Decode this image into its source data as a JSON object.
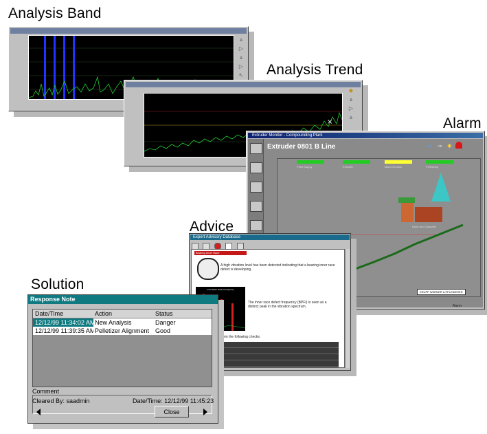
{
  "labels": {
    "analysis_band": "Analysis Band",
    "analysis_trend": "Analysis Trend",
    "alarm": "Alarm",
    "advice": "Advice",
    "solution": "Solution"
  },
  "alarm_window": {
    "title": "Extruder Monitor - Compounding Plant",
    "heading": "Extruder 0801 B Line",
    "indicators": [
      {
        "label": "Feed Supply",
        "color": "#22cc22"
      },
      {
        "label": "Extruder",
        "color": "#22cc22"
      },
      {
        "label": "Main Electrics",
        "color": "#ffff33"
      },
      {
        "label": "Pelletizing",
        "color": "#22cc22"
      }
    ],
    "equipment_label": "Dryer and Classifier",
    "vendor": "KRUPP WERNER & PFLEIDERER",
    "status_left": "Alarm"
  },
  "advice_window": {
    "title": "Expert Advisory Database",
    "header": "Bearing Inner Race",
    "text_1": "A high vibration level has been detected indicating that a bearing inner race defect is developing.",
    "spectrum_title": "Inner Race Defect Frequency",
    "text_2": "The inner race defect frequency (BPFI) is seen as a distinct peak in the vibration spectrum.",
    "text_3": "You must first perform the following checks:"
  },
  "response_note": {
    "title": "Response Note",
    "columns": [
      "Date/Time",
      "Action",
      "Status"
    ],
    "rows": [
      {
        "datetime": "12/12/99 11:34:02 AM",
        "action": "New Analysis",
        "status": "Danger"
      },
      {
        "datetime": "12/12/99 11:39:35 AM",
        "action": "Pelletizer Alignment",
        "status": "Good"
      }
    ],
    "comment_label": "Comment",
    "cleared_by": "Cleared By: saadmin",
    "date_time": "Date/Time:  12/12/99 11:45:23",
    "close_label": "Close"
  },
  "colors": {
    "response_title": "#0f7a80",
    "selected_row": "#0f7a80",
    "plot_trace": "#22cc33",
    "band_marker": "#2233ff",
    "advice_title": "#1a6a8c"
  }
}
